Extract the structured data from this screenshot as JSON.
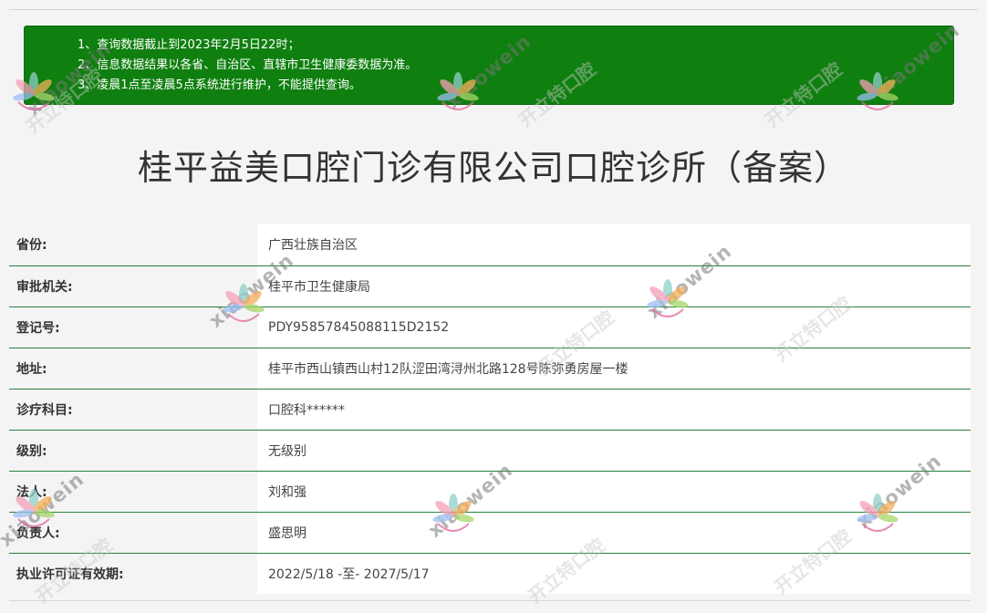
{
  "notice": {
    "items": [
      "1、查询数据截止到2023年2月5日22时；",
      "2、信息数据结果以各省、自治区、直辖市卫生健康委数据为准。",
      "3、凌晨1点至凌晨5点系统进行维护，不能提供查询。"
    ]
  },
  "page_title": "桂平益美口腔门诊有限公司口腔诊所（备案）",
  "rows": [
    {
      "label": "省份:",
      "value": "广西壮族自治区"
    },
    {
      "label": "审批机关:",
      "value": "桂平市卫生健康局"
    },
    {
      "label": "登记号:",
      "value": "PDY95857845088115D2152"
    },
    {
      "label": "地址:",
      "value": "桂平市西山镇西山村12队涩田湾浔州北路128号陈弥勇房屋一楼"
    },
    {
      "label": "诊疗科目:",
      "value": "口腔科******"
    },
    {
      "label": "级别:",
      "value": "无级别"
    },
    {
      "label": "法人:",
      "value": "刘和强"
    },
    {
      "label": "负责人:",
      "value": "盛思明"
    },
    {
      "label": "执业许可证有效期:",
      "value": "2022/5/18 -至- 2027/5/17"
    }
  ],
  "watermark": {
    "brand_en": "xiaowein",
    "brand_cn": "开立特口腔"
  },
  "colors": {
    "notice_bg": "#0f7f0f",
    "row_border": "#27803c"
  }
}
